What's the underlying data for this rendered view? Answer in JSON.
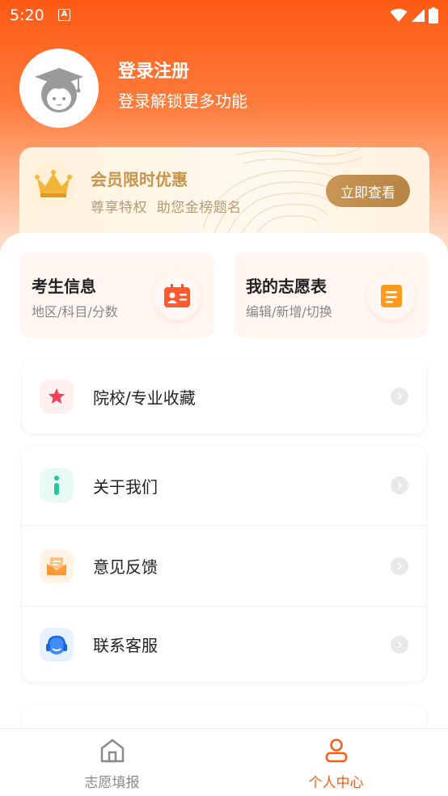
{
  "status_bar": {
    "time": "5:20",
    "notification_glyph": "A"
  },
  "profile": {
    "title": "登录注册",
    "subtitle": "登录解锁更多功能"
  },
  "vip": {
    "title": "会员限时优惠",
    "subtitle": "尊享特权  助您金榜题名",
    "button": "立即查看"
  },
  "quick_cards": [
    {
      "title": "考生信息",
      "subtitle": "地区/科目/分数",
      "icon": "id-card-icon"
    },
    {
      "title": "我的志愿表",
      "subtitle": "编辑/新增/切换",
      "icon": "document-icon"
    }
  ],
  "menu_group_1": [
    {
      "label": "院校/专业收藏",
      "icon": "star-icon"
    }
  ],
  "menu_group_2": [
    {
      "label": "关于我们",
      "icon": "info-icon"
    },
    {
      "label": "意见反馈",
      "icon": "feedback-mail-icon"
    },
    {
      "label": "联系客服",
      "icon": "headset-icon"
    }
  ],
  "bottom_nav": [
    {
      "label": "志愿填报",
      "icon": "home-icon",
      "active": false
    },
    {
      "label": "个人中心",
      "icon": "user-icon",
      "active": true
    }
  ],
  "colors": {
    "brand": "#ff5a14",
    "vip_gold": "#c8934a",
    "text_primary": "#222222",
    "text_secondary": "#888888"
  }
}
